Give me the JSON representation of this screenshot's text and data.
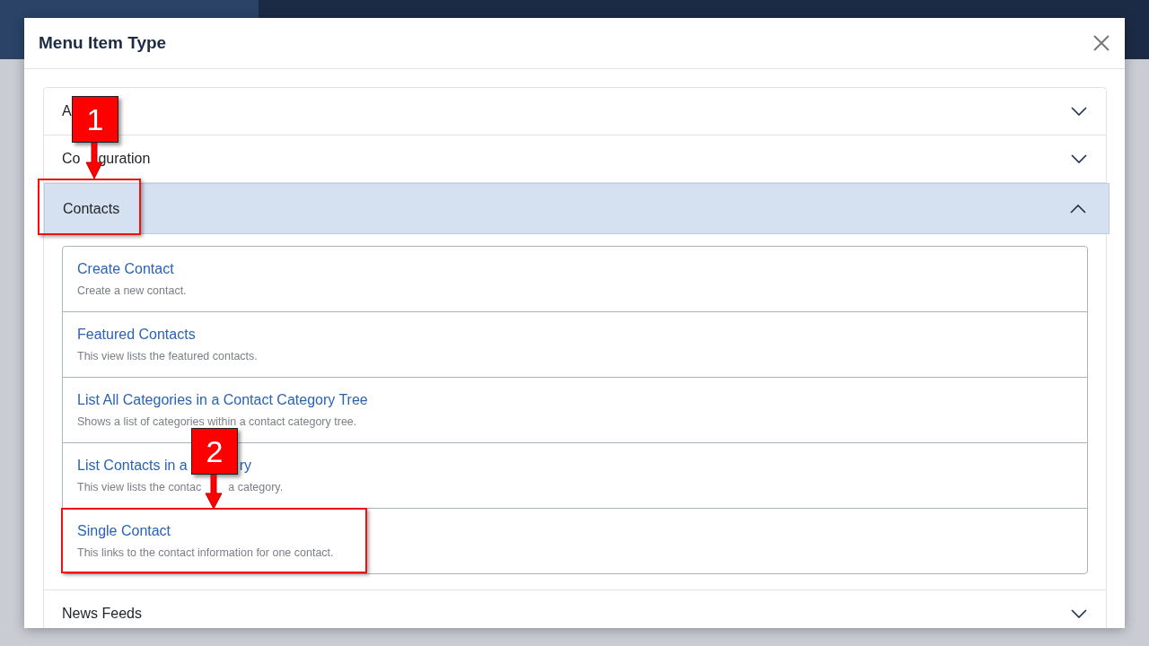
{
  "dialog": {
    "title": "Menu Item Type",
    "sections": [
      {
        "label": "A",
        "expanded": false
      },
      {
        "label": [
          "Co",
          "guration"
        ],
        "expanded": false
      },
      {
        "label": "Contacts",
        "expanded": true,
        "callout": "1",
        "items": [
          {
            "title": "Create Contact",
            "description": "Create a new contact."
          },
          {
            "title": "Featured Contacts",
            "description": "This view lists the featured contacts."
          },
          {
            "title": "List All Categories in a Contact Category Tree",
            "description": "Shows a list of categories within a contact category tree."
          },
          {
            "title": [
              "List Contacts in a",
              "ry"
            ],
            "description": [
              "This view lists the contac",
              "a category."
            ]
          },
          {
            "title": "Single Contact",
            "description": "This links to the contact information for one contact.",
            "callout": "2"
          }
        ]
      },
      {
        "label": "News Feeds",
        "expanded": false
      }
    ]
  }
}
